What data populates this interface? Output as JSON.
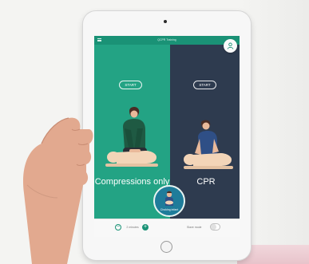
{
  "app": {
    "title": "QCPR Training",
    "profile_icon": "person-icon",
    "menu_icon": "hamburger-menu-icon"
  },
  "modes": {
    "compressions": {
      "start_label": "START",
      "label": "Compressions only"
    },
    "cpr": {
      "start_label": "START",
      "label": "CPR"
    },
    "choking": {
      "label": "Choking infant"
    }
  },
  "footer": {
    "minus_label": "−",
    "duration": "2 minutes",
    "plus_label": "+",
    "slave_mode_label": "Slave mode",
    "slave_mode_on": false
  },
  "colors": {
    "compressions_panel": "#23a384",
    "cpr_panel": "#2e3b4f",
    "topbar": "#1a9276",
    "choking_bubble": "#1e7c9a"
  }
}
